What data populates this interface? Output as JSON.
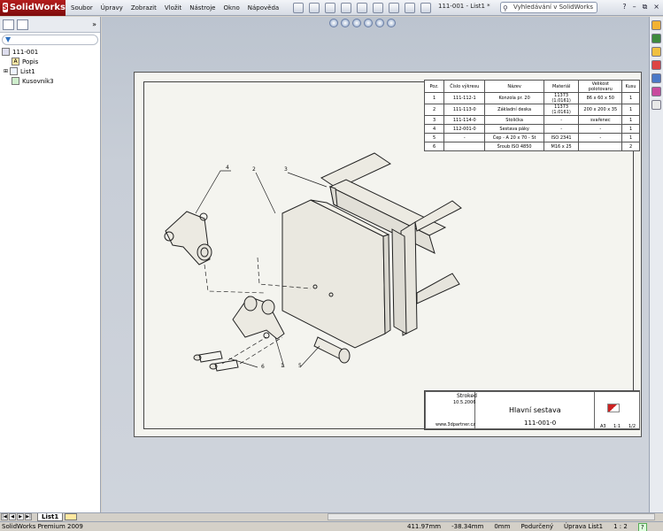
{
  "app": {
    "name": "SolidWorks",
    "document_title": "111-001 - List1 *",
    "search_placeholder": "Vyhledávání v SolidWorks",
    "help": "?",
    "min": "–",
    "restore": "⧉",
    "close": "×"
  },
  "menus": [
    "Soubor",
    "Úpravy",
    "Zobrazit",
    "Vložit",
    "Nástroje",
    "Okno",
    "Nápověda"
  ],
  "tree": {
    "root": "111-001",
    "items": [
      {
        "label": "Popis",
        "icon": "annotation-icon"
      },
      {
        "label": "List1",
        "icon": "sheet-icon"
      },
      {
        "label": "Kusovník3",
        "icon": "bom-icon"
      }
    ]
  },
  "bom": {
    "headers": [
      "Poz.",
      "Číslo výkresu",
      "Název",
      "Materiál",
      "Velikost polotovaru",
      "Kusu"
    ],
    "rows": [
      [
        "1",
        "111-112-1",
        "Konzola pr. 20",
        "11373 (1.0161)",
        "86 x 60 x 50",
        "1"
      ],
      [
        "2",
        "111-113-0",
        "Základní deska",
        "11373 (1.0161)",
        "200 x 200 x 35",
        "1"
      ],
      [
        "3",
        "111-114-0",
        "Stolička",
        "-",
        "svařenec",
        "1"
      ],
      [
        "4",
        "112-001-0",
        "Sestava páky",
        "-",
        "-",
        "1"
      ],
      [
        "5",
        "-",
        "Čep - A 20 x 70 - St",
        "ISO 2341",
        "-",
        "1"
      ],
      [
        "6",
        "",
        "Šroub ISO 4850",
        "M16 x 25",
        "",
        "2"
      ]
    ]
  },
  "titleblock": {
    "stroked_label": "Stroked",
    "date": "10.5.2006",
    "title": "Hlavní sestava",
    "number": "111-001-0",
    "web": "www.3dpartner.cz",
    "format": "A3",
    "scale": "1:1",
    "page": "1/2"
  },
  "balloons": [
    "4",
    "2",
    "3",
    "6",
    "1",
    "5"
  ],
  "sheet_tab": "List1",
  "status": {
    "app": "SolidWorks Premium 2009",
    "x": "411.97mm",
    "y": "-38.34mm",
    "z": "0mm",
    "state": "Podurčený",
    "edit": "Úprava List1",
    "scale": "1 : 2"
  },
  "colors": {
    "accent": "#b31e1e",
    "canvas": "#c8ced7",
    "sheet": "#f4f4ef"
  }
}
